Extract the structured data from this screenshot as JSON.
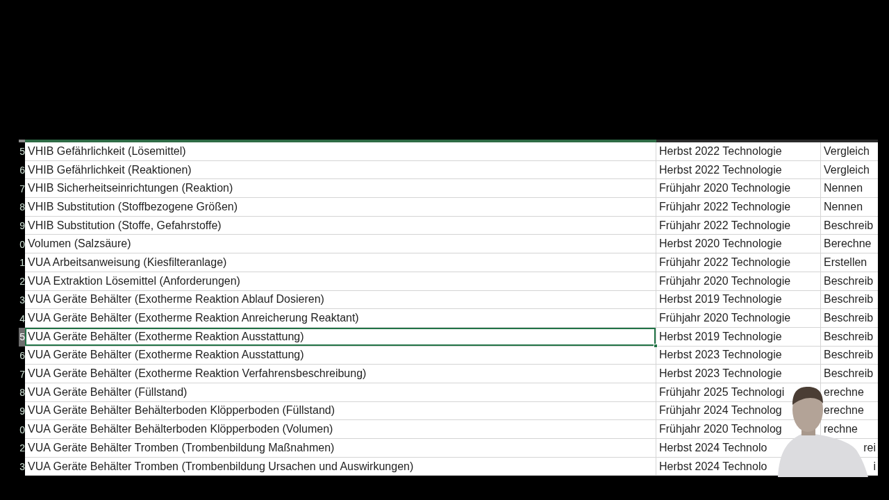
{
  "column_headers": [
    {
      "selected": true
    },
    {
      "selected": false
    },
    {
      "selected": false
    }
  ],
  "rows": [
    {
      "number": "5",
      "selected": false,
      "cells": [
        "VHIB Gefährlichkeit (Lösemittel)",
        "Herbst 2022 Technologie",
        "Vergleich"
      ]
    },
    {
      "number": "6",
      "selected": false,
      "cells": [
        "VHIB Gefährlichkeit (Reaktionen)",
        "Herbst 2022 Technologie",
        "Vergleich"
      ]
    },
    {
      "number": "7",
      "selected": false,
      "cells": [
        "VHIB Sicherheitseinrichtungen (Reaktion)",
        "Frühjahr 2020 Technologie",
        "Nennen"
      ]
    },
    {
      "number": "8",
      "selected": false,
      "cells": [
        "VHIB Substitution (Stoffbezogene Größen)",
        "Frühjahr 2022 Technologie",
        "Nennen"
      ]
    },
    {
      "number": "9",
      "selected": false,
      "cells": [
        "VHIB Substitution (Stoffe, Gefahrstoffe)",
        "Frühjahr 2022 Technologie",
        "Beschreib"
      ]
    },
    {
      "number": "0",
      "selected": false,
      "cells": [
        "Volumen (Salzsäure)",
        "Herbst 2020 Technologie",
        "Berechne"
      ]
    },
    {
      "number": "1",
      "selected": false,
      "cells": [
        "VUA Arbeitsanweisung (Kiesfilteranlage)",
        "Frühjahr 2022 Technologie",
        "Erstellen"
      ]
    },
    {
      "number": "2",
      "selected": false,
      "cells": [
        "VUA Extraktion Lösemittel (Anforderungen)",
        "Frühjahr 2020 Technologie",
        "Beschreib"
      ]
    },
    {
      "number": "3",
      "selected": false,
      "cells": [
        "VUA Geräte Behälter (Exotherme Reaktion Ablauf Dosieren)",
        "Herbst 2019 Technologie",
        "Beschreib"
      ]
    },
    {
      "number": "4",
      "selected": false,
      "cells": [
        "VUA Geräte Behälter (Exotherme Reaktion Anreicherung Reaktant)",
        "Frühjahr 2020 Technologie",
        "Beschreib"
      ]
    },
    {
      "number": "5",
      "selected": true,
      "cells": [
        "VUA Geräte Behälter (Exotherme Reaktion Ausstattung)",
        "Herbst 2019 Technologie",
        "Beschreib"
      ]
    },
    {
      "number": "6",
      "selected": false,
      "cells": [
        "VUA Geräte Behälter (Exotherme Reaktion Ausstattung)",
        "Herbst 2023 Technologie",
        "Beschreib"
      ]
    },
    {
      "number": "7",
      "selected": false,
      "cells": [
        "VUA Geräte Behälter (Exotherme Reaktion Verfahrensbeschreibung)",
        "Herbst 2023 Technologie",
        "Beschreib"
      ]
    },
    {
      "number": "8",
      "selected": false,
      "cells": [
        "VUA Geräte Behälter (Füllstand)",
        "Frühjahr 2025 Technologi",
        "erechne"
      ]
    },
    {
      "number": "9",
      "selected": false,
      "cells": [
        "VUA Geräte Behälter Behälterboden Klöpperboden (Füllstand)",
        "Frühjahr 2024 Technolog",
        "erechne"
      ]
    },
    {
      "number": "0",
      "selected": false,
      "cells": [
        "VUA Geräte Behälter Behälterboden Klöpperboden (Volumen)",
        "Frühjahr 2020 Technolog",
        "rechne"
      ]
    },
    {
      "number": "2",
      "selected": false,
      "cells": [
        "VUA Geräte Behälter Tromben (Trombenbildung Maßnahmen)",
        "Herbst 2024 Technolo",
        "rei"
      ]
    },
    {
      "number": "3",
      "selected": false,
      "cells": [
        "VUA Geräte Behälter Tromben (Trombenbildung Ursachen und Auswirkungen)",
        "Herbst 2024 Technolo",
        "i"
      ]
    }
  ],
  "webcam_overlay": {
    "kind": "person"
  }
}
